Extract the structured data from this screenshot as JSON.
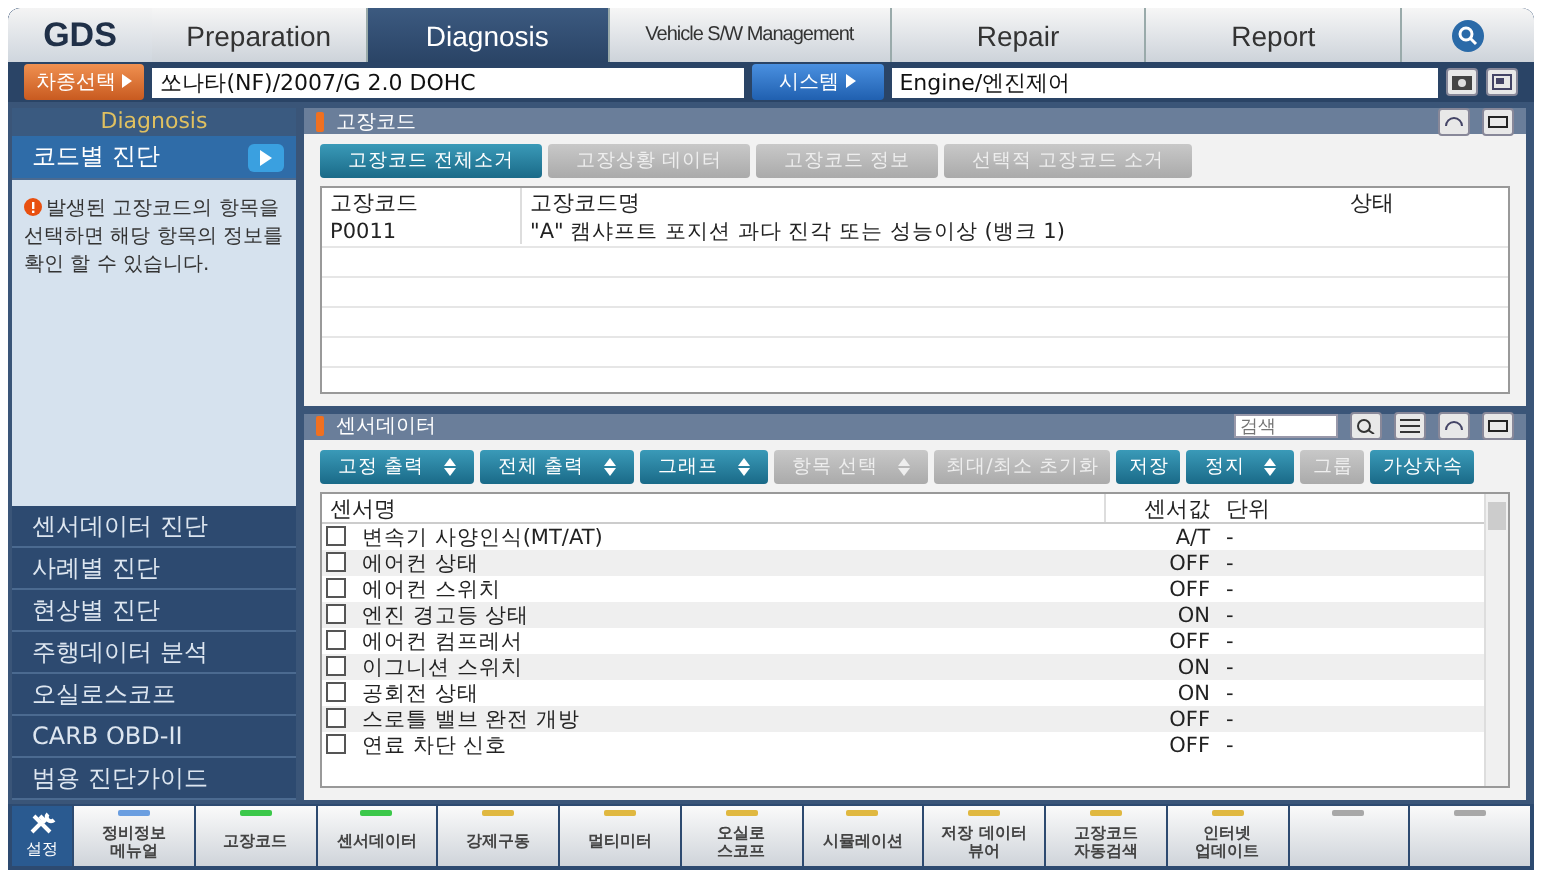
{
  "logo": "GDS",
  "top_tabs": [
    {
      "label": "Preparation",
      "selected": false
    },
    {
      "label": "Diagnosis",
      "selected": true
    },
    {
      "label": "Vehicle S/W Management",
      "selected": false,
      "kind": "narrow"
    },
    {
      "label": "Repair",
      "selected": false
    },
    {
      "label": "Report",
      "selected": false
    }
  ],
  "vehicle": {
    "label": "차종선택",
    "value": "쏘나타(NF)/2007/G 2.0 DOHC"
  },
  "system": {
    "label": "시스템",
    "value": "Engine/엔진제어"
  },
  "sidebar": {
    "title": "Diagnosis",
    "info": "발생된 고장코드의 항목을 선택하면 해당 항목의 정보를 확인 할 수 있습니다.",
    "items": [
      {
        "label": "코드별 진단",
        "selected": true
      },
      {
        "label": "센서데이터 진단",
        "selected": false
      },
      {
        "label": "사례별 진단",
        "selected": false
      },
      {
        "label": "현상별 진단",
        "selected": false
      },
      {
        "label": "주행데이터 분석",
        "selected": false
      },
      {
        "label": "오실로스코프",
        "selected": false
      },
      {
        "label": "CARB OBD-II",
        "selected": false
      },
      {
        "label": "범용 진단가이드",
        "selected": false
      }
    ]
  },
  "fault_panel": {
    "title": "고장코드",
    "buttons": [
      {
        "label": "고장코드 전체소거",
        "disabled": false
      },
      {
        "label": "고장상황 데이터",
        "disabled": true
      },
      {
        "label": "고장코드 정보",
        "disabled": true
      },
      {
        "label": "선택적 고장코드 소거",
        "disabled": true
      }
    ],
    "columns": [
      "고장코드",
      "고장코드명",
      "상태"
    ],
    "rows": [
      {
        "code": "P0011",
        "name": "\"A\" 캠샤프트 포지션 과다 진각 또는 성능이상 (뱅크 1)"
      }
    ]
  },
  "sensor_panel": {
    "title": "센서데이터",
    "search": {
      "placeholder": "검색"
    },
    "buttons": [
      {
        "label": "고정 출력",
        "disabled": false,
        "dropdown": true
      },
      {
        "label": "전체 출력",
        "disabled": false,
        "dropdown": true
      },
      {
        "label": "그래프",
        "disabled": false,
        "dropdown": true
      },
      {
        "label": "항목 선택",
        "disabled": true,
        "dropdown": true
      },
      {
        "label": "최대/최소 초기화",
        "disabled": true,
        "dropdown": false
      },
      {
        "label": "저장",
        "disabled": false,
        "dropdown": false
      },
      {
        "label": "정지",
        "disabled": false,
        "dropdown": true
      },
      {
        "label": "그룹",
        "disabled": true,
        "dropdown": false
      },
      {
        "label": "가상차속",
        "disabled": false,
        "dropdown": false
      }
    ],
    "columns": [
      "센서명",
      "센서값",
      "단위"
    ],
    "rows": [
      {
        "name": "변속기 사양인식(MT/AT)",
        "checked": false,
        "value": "A/T",
        "unit": "-"
      },
      {
        "name": "에어컨 상태",
        "checked": false,
        "value": "OFF",
        "unit": "-"
      },
      {
        "name": "에어컨 스위치",
        "checked": false,
        "value": "OFF",
        "unit": "-"
      },
      {
        "name": "엔진 경고등 상태",
        "checked": false,
        "value": "ON",
        "unit": "-"
      },
      {
        "name": "에어컨 컴프레서",
        "checked": false,
        "value": "OFF",
        "unit": "-"
      },
      {
        "name": "이그니션 스위치",
        "checked": false,
        "value": "ON",
        "unit": "-"
      },
      {
        "name": "공회전 상태",
        "checked": false,
        "value": "ON",
        "unit": "-"
      },
      {
        "name": "스로틀 밸브 완전 개방",
        "checked": false,
        "value": "OFF",
        "unit": "-"
      },
      {
        "name": "연료 차단 신호",
        "checked": false,
        "value": "OFF",
        "unit": "-"
      }
    ]
  },
  "bottom_tabs": [
    {
      "label": "설정",
      "kind": "settings"
    },
    {
      "label": "정비정보\n메뉴얼",
      "kind": "tab",
      "color": "#6a9ee0"
    },
    {
      "label": "고장코드",
      "kind": "tab",
      "color": "#3cc84a"
    },
    {
      "label": "센서데이터",
      "kind": "tab",
      "color": "#3cc84a"
    },
    {
      "label": "강제구동",
      "kind": "tab",
      "color": "#e0b840"
    },
    {
      "label": "멀티미터",
      "kind": "tab",
      "color": "#e0b840"
    },
    {
      "label": "오실로\n스코프",
      "kind": "tab",
      "color": "#e0b840"
    },
    {
      "label": "시뮬레이션",
      "kind": "tab",
      "color": "#e0b840"
    },
    {
      "label": "저장 데이터\n뷰어",
      "kind": "tab",
      "color": "#e0b840"
    },
    {
      "label": "고장코드\n자동검색",
      "kind": "tab",
      "color": "#e0b840"
    },
    {
      "label": "인터넷\n업데이트",
      "kind": "tab",
      "color": "#e0b840"
    },
    {
      "kind": "tab",
      "color": "#a8a8a8"
    },
    {
      "kind": "tab",
      "color": "#a8a8a8"
    }
  ]
}
